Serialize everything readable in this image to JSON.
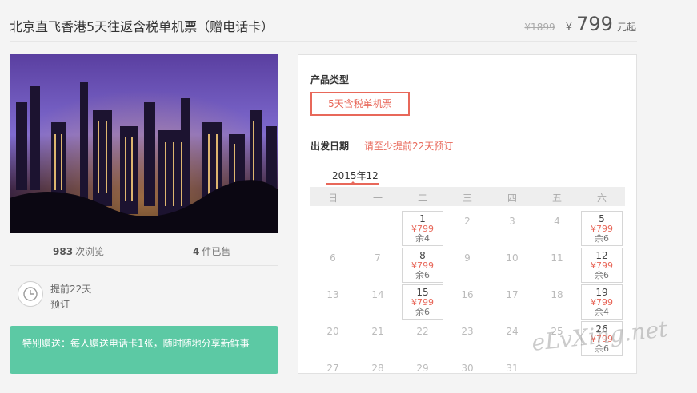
{
  "title": "北京直飞香港5天往返含税单机票（赠电话卡）",
  "price": {
    "original": "¥1899",
    "currency": "¥",
    "current": "799",
    "suffix": "元起"
  },
  "stats": {
    "views_count": "983",
    "views_label": "次浏览",
    "sold_count": "4",
    "sold_label": "件已售"
  },
  "advance": {
    "line1": "提前22天",
    "line2": "预订"
  },
  "gift": {
    "text": "特别赠送：每人赠送电话卡1张，随时随地分享新鲜事"
  },
  "booking": {
    "product_type_label": "产品类型",
    "product_type_option": "5天含税单机票",
    "date_label": "出发日期",
    "date_hint": "请至少提前22天预订",
    "month": "2015年12",
    "weekdays": [
      "日",
      "一",
      "二",
      "三",
      "四",
      "五",
      "六"
    ],
    "weeks": [
      [
        null,
        null,
        {
          "day": "1",
          "price": "¥799",
          "remain": "余4"
        },
        {
          "day": "2"
        },
        {
          "day": "3"
        },
        {
          "day": "4"
        },
        {
          "day": "5",
          "price": "¥799",
          "remain": "余6"
        }
      ],
      [
        {
          "day": "6"
        },
        {
          "day": "7"
        },
        {
          "day": "8",
          "price": "¥799",
          "remain": "余6"
        },
        {
          "day": "9"
        },
        {
          "day": "10"
        },
        {
          "day": "11"
        },
        {
          "day": "12",
          "price": "¥799",
          "remain": "余6"
        }
      ],
      [
        {
          "day": "13"
        },
        {
          "day": "14"
        },
        {
          "day": "15",
          "price": "¥799",
          "remain": "余6"
        },
        {
          "day": "16"
        },
        {
          "day": "17"
        },
        {
          "day": "18"
        },
        {
          "day": "19",
          "price": "¥799",
          "remain": "余4"
        }
      ],
      [
        {
          "day": "20"
        },
        {
          "day": "21"
        },
        {
          "day": "22"
        },
        {
          "day": "23"
        },
        {
          "day": "24"
        },
        {
          "day": "25"
        },
        {
          "day": "26",
          "price": "¥799",
          "remain": "余6"
        }
      ],
      [
        {
          "day": "27"
        },
        {
          "day": "28"
        },
        {
          "day": "29"
        },
        {
          "day": "30"
        },
        {
          "day": "31"
        },
        null,
        null
      ]
    ]
  },
  "watermark": "eLvXing.net",
  "colors": {
    "accent": "#e8685a",
    "gift_bg": "#5cc9a4"
  }
}
